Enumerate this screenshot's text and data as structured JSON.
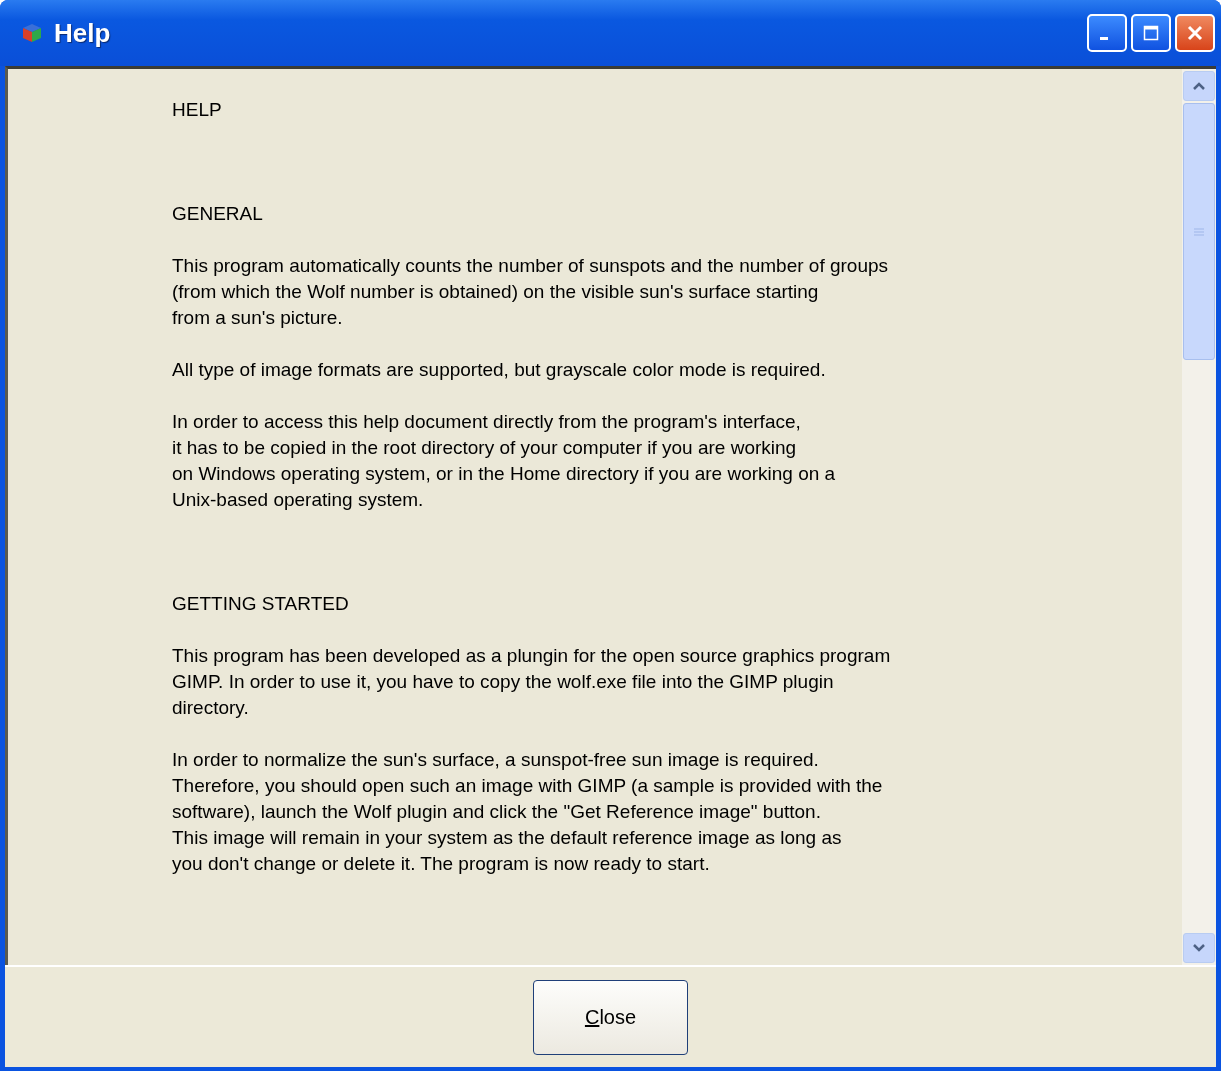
{
  "window": {
    "title": "Help"
  },
  "blocks": [
    {
      "kind": "heading",
      "lines": [
        "HELP"
      ]
    },
    {
      "kind": "heading",
      "lines": [
        "GENERAL"
      ]
    },
    {
      "kind": "paragraph",
      "lines": [
        "This program automatically counts the number of sunspots and the number of groups",
        "(from which the Wolf number is obtained) on the visible sun's surface starting",
        "from a sun's picture."
      ]
    },
    {
      "kind": "paragraph",
      "lines": [
        "All type of image formats are supported, but grayscale color mode is required."
      ]
    },
    {
      "kind": "paragraph",
      "lines": [
        "In order to access this help document directly from the program's interface,",
        "it has to be copied in the root directory of your computer if you are working",
        "on Windows operating system, or in the Home directory if you are working on a",
        "Unix-based operating system."
      ]
    },
    {
      "kind": "heading",
      "lines": [
        "GETTING STARTED"
      ]
    },
    {
      "kind": "paragraph",
      "lines": [
        "This program has been developed as a plungin for the open source graphics program",
        "GIMP. In order to use it, you have to copy the wolf.exe file into the GIMP plugin",
        "directory."
      ]
    },
    {
      "kind": "paragraph",
      "lines": [
        "In order to normalize the sun's surface, a sunspot-free sun image is required.",
        "Therefore, you should open such an image with GIMP (a sample is provided with the",
        "software), launch the Wolf plugin and click the \"Get Reference image\" button.",
        "This image will remain in your system as the default reference image as long as",
        "you don't change or delete it. The program is now ready to start."
      ]
    }
  ],
  "buttons": [
    {
      "label": "Close"
    }
  ]
}
